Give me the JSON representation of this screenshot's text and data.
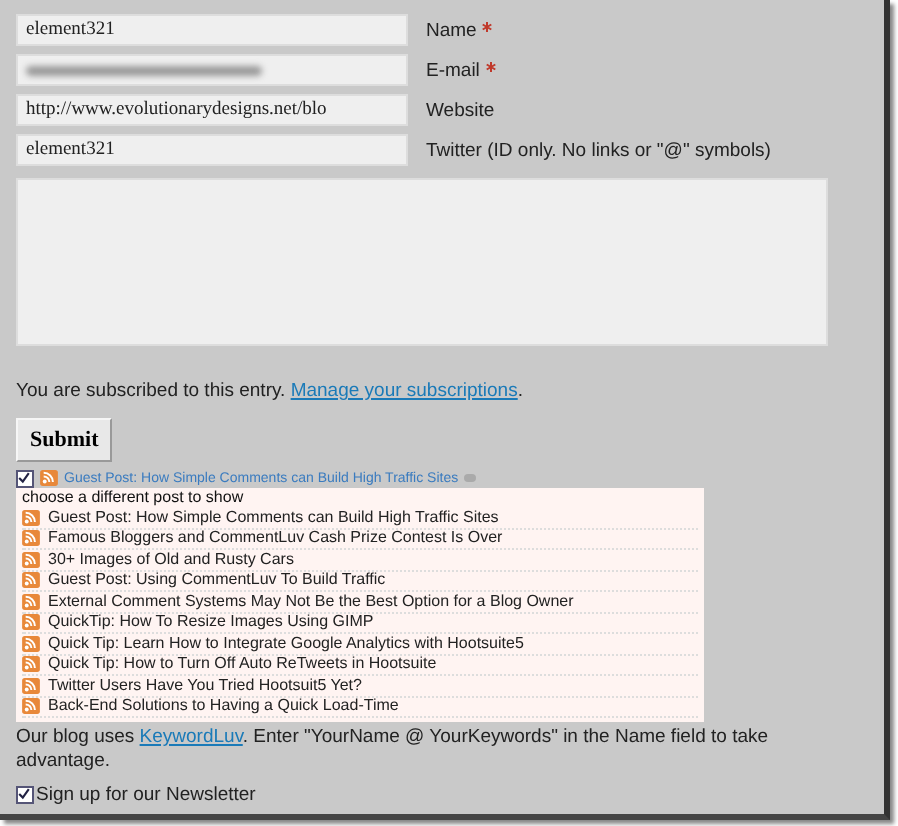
{
  "fields": [
    {
      "value": "element321",
      "label": "Name",
      "required": true,
      "kind": "text"
    },
    {
      "label": "E-mail",
      "required": true,
      "kind": "blurred"
    },
    {
      "value": "http://www.evolutionarydesigns.net/blo",
      "label": "Website",
      "required": false,
      "kind": "text"
    },
    {
      "value": "element321",
      "label": "Twitter (ID only. No links or \"@\" symbols)",
      "required": false,
      "kind": "text"
    }
  ],
  "subscription": {
    "text": "You are subscribed to this entry.",
    "link": "Manage your subscriptions",
    "end": "."
  },
  "submit": "Submit",
  "commentluv": {
    "checked": true,
    "title": "Guest Post: How Simple Comments can Build High Traffic Sites",
    "prompt": "choose a different post to show",
    "posts": [
      "Guest Post: How Simple Comments can Build High Traffic Sites",
      "Famous Bloggers and CommentLuv Cash Prize Contest Is Over",
      "30+ Images of Old and Rusty Cars",
      "Guest Post: Using CommentLuv To Build Traffic",
      "External Comment Systems May Not Be the Best Option for a Blog Owner",
      "QuickTip: How To Resize Images Using GIMP",
      "Quick Tip: Learn How to Integrate Google Analytics with Hootsuite5",
      "Quick Tip: How to Turn Off Auto ReTweets in Hootsuite",
      "Twitter Users Have You Tried Hootsuit5 Yet?",
      "Back-End Solutions to Having a Quick Load-Time"
    ]
  },
  "keywordluv": {
    "before": "Our blog uses",
    "link": "KeywordLuv",
    "after": ". Enter \"YourName @ YourKeywords\" in the Name field to take advantage."
  },
  "newsletter": {
    "label": "Sign up for our Newsletter",
    "checked": true
  }
}
